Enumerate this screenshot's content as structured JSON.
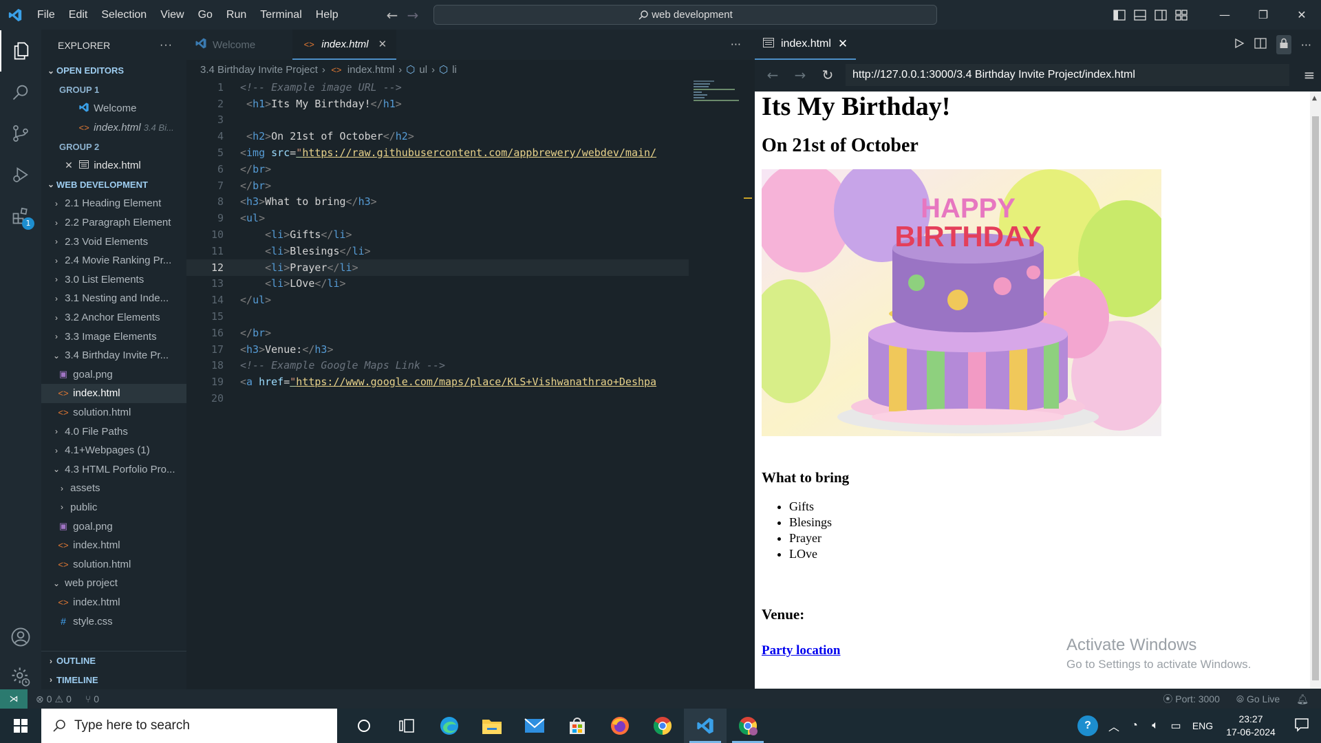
{
  "titlebar": {
    "menus": [
      "File",
      "Edit",
      "Selection",
      "View",
      "Go",
      "Run",
      "Terminal",
      "Help"
    ],
    "search_text": "web development"
  },
  "sidebar": {
    "title": "EXPLORER",
    "more": "···",
    "open_editors": "OPEN EDITORS",
    "group1": "GROUP 1",
    "group1_items": [
      {
        "label": "Welcome",
        "icon": "vscode-icon"
      },
      {
        "label": "index.html",
        "desc": "3.4 Bi...",
        "icon": "html-icon"
      }
    ],
    "group2": "GROUP 2",
    "group2_items": [
      {
        "label": "index.html",
        "icon": "preview-icon"
      }
    ],
    "workspace": "WEB DEVELOPMENT",
    "tree": [
      {
        "label": "2.1 Heading Element",
        "type": "folder",
        "depth": 1
      },
      {
        "label": "2.2 Paragraph Element",
        "type": "folder",
        "depth": 1
      },
      {
        "label": "2.3 Void Elements",
        "type": "folder",
        "depth": 1
      },
      {
        "label": "2.4 Movie Ranking Pr...",
        "type": "folder",
        "depth": 1
      },
      {
        "label": "3.0 List Elements",
        "type": "folder",
        "depth": 1
      },
      {
        "label": "3.1 Nesting and Inde...",
        "type": "folder",
        "depth": 1
      },
      {
        "label": "3.2 Anchor Elements",
        "type": "folder",
        "depth": 1
      },
      {
        "label": "3.3 Image Elements",
        "type": "folder",
        "depth": 1
      },
      {
        "label": "3.4 Birthday Invite Pr...",
        "type": "folder-open",
        "depth": 1
      },
      {
        "label": "goal.png",
        "type": "img",
        "depth": 2
      },
      {
        "label": "index.html",
        "type": "html",
        "depth": 2,
        "selected": true
      },
      {
        "label": "solution.html",
        "type": "html",
        "depth": 2
      },
      {
        "label": "4.0 File Paths",
        "type": "folder",
        "depth": 1
      },
      {
        "label": "4.1+Webpages (1)",
        "type": "folder",
        "depth": 1
      },
      {
        "label": "4.3 HTML Porfolio Pro...",
        "type": "folder-open",
        "depth": 1
      },
      {
        "label": "assets",
        "type": "folder",
        "depth": 2
      },
      {
        "label": "public",
        "type": "folder",
        "depth": 2
      },
      {
        "label": "goal.png",
        "type": "img",
        "depth": 2
      },
      {
        "label": "index.html",
        "type": "html",
        "depth": 2
      },
      {
        "label": "solution.html",
        "type": "html",
        "depth": 2
      },
      {
        "label": "web project",
        "type": "folder-open",
        "depth": 1
      },
      {
        "label": "index.html",
        "type": "html",
        "depth": 2
      },
      {
        "label": "style.css",
        "type": "css",
        "depth": 2
      }
    ],
    "outline": "OUTLINE",
    "timeline": "TIMELINE"
  },
  "editor": {
    "tabs": [
      {
        "label": "Welcome",
        "active": false
      },
      {
        "label": "index.html",
        "active": true
      }
    ],
    "more": "···",
    "breadcrumb": [
      "3.4 Birthday Invite Project",
      "index.html",
      "ul",
      "li"
    ],
    "current_line": 12,
    "lines": [
      {
        "n": "1",
        "html": "<span class=\"cm\">&lt;!-- Example image URL --&gt;</span>"
      },
      {
        "n": "2",
        "html": " <span class=\"gr\">&lt;</span><span class=\"tg\">h1</span><span class=\"gr\">&gt;</span>Its My Birthday!<span class=\"gr\">&lt;/</span><span class=\"tg\">h1</span><span class=\"gr\">&gt;</span>"
      },
      {
        "n": "3",
        "html": ""
      },
      {
        "n": "4",
        "html": " <span class=\"gr\">&lt;</span><span class=\"tg\">h2</span><span class=\"gr\">&gt;</span>On 21st of October<span class=\"gr\">&lt;/</span><span class=\"tg\">h2</span><span class=\"gr\">&gt;</span>"
      },
      {
        "n": "5",
        "html": "<span class=\"gr\">&lt;</span><span class=\"tg\">img</span> <span class=\"at\">src</span>=<span class=\"st\">\"</span><span class=\"url\">https://raw.githubusercontent.com/appbrewery/webdev/main/</span>"
      },
      {
        "n": "6",
        "html": "<span class=\"gr\">&lt;/</span><span class=\"tg\">br</span><span class=\"gr\">&gt;</span>"
      },
      {
        "n": "7",
        "html": "<span class=\"gr\">&lt;/</span><span class=\"tg\">br</span><span class=\"gr\">&gt;</span>"
      },
      {
        "n": "8",
        "html": "<span class=\"gr\">&lt;</span><span class=\"tg\">h3</span><span class=\"gr\">&gt;</span>What to bring<span class=\"gr\">&lt;/</span><span class=\"tg\">h3</span><span class=\"gr\">&gt;</span>"
      },
      {
        "n": "9",
        "html": "<span class=\"gr\">&lt;</span><span class=\"tg\">ul</span><span class=\"gr\">&gt;</span>"
      },
      {
        "n": "10",
        "html": "    <span class=\"gr\">&lt;</span><span class=\"tg\">li</span><span class=\"gr\">&gt;</span>Gifts<span class=\"gr\">&lt;/</span><span class=\"tg\">li</span><span class=\"gr\">&gt;</span>"
      },
      {
        "n": "11",
        "html": "    <span class=\"gr\">&lt;</span><span class=\"tg\">li</span><span class=\"gr\">&gt;</span>Blesings<span class=\"gr\">&lt;/</span><span class=\"tg\">li</span><span class=\"gr\">&gt;</span>"
      },
      {
        "n": "12",
        "html": "    <span class=\"gr\">&lt;</span><span class=\"tg\">li</span><span class=\"gr\">&gt;</span>Prayer<span class=\"gr\">&lt;/</span><span class=\"tg\">li</span><span class=\"gr\">&gt;</span>"
      },
      {
        "n": "13",
        "html": "    <span class=\"gr\">&lt;</span><span class=\"tg\">li</span><span class=\"gr\">&gt;</span>LOve<span class=\"gr\">&lt;/</span><span class=\"tg\">li</span><span class=\"gr\">&gt;</span>"
      },
      {
        "n": "14",
        "html": "<span class=\"gr\">&lt;/</span><span class=\"tg\">ul</span><span class=\"gr\">&gt;</span>"
      },
      {
        "n": "15",
        "html": ""
      },
      {
        "n": "16",
        "html": "<span class=\"gr\">&lt;/</span><span class=\"tg\">br</span><span class=\"gr\">&gt;</span>"
      },
      {
        "n": "17",
        "html": "<span class=\"gr\">&lt;</span><span class=\"tg\">h3</span><span class=\"gr\">&gt;</span>Venue:<span class=\"gr\">&lt;/</span><span class=\"tg\">h3</span><span class=\"gr\">&gt;</span>"
      },
      {
        "n": "18",
        "html": "<span class=\"cm\">&lt;!-- Example Google Maps Link --&gt;</span>"
      },
      {
        "n": "19",
        "html": "<span class=\"gr\">&lt;</span><span class=\"tg\">a</span> <span class=\"at\">href</span>=<span class=\"st\">\"</span><span class=\"url\">https://www.google.com/maps/place/KLS+Vishwanathrao+Deshpa</span>"
      },
      {
        "n": "20",
        "html": ""
      }
    ]
  },
  "preview": {
    "tab_label": "index.html",
    "url": "http://127.0.0.1:3000/3.4 Birthday Invite Project/index.html",
    "page": {
      "h1": "Its My Birthday!",
      "h2": "On 21st of October",
      "image_alt": "HAPPY BIRTHDAY cake",
      "cake_text_top": "HAPPY",
      "cake_text_bottom": "BIRTHDAY",
      "h3_bring": "What to bring",
      "items": [
        "Gifts",
        "Blesings",
        "Prayer",
        "LOve"
      ],
      "h3_venue": "Venue:",
      "link": "Party location"
    }
  },
  "watermark": {
    "title": "Activate Windows",
    "sub": "Go to Settings to activate Windows."
  },
  "statusbar": {
    "errors": "0",
    "warnings": "0",
    "ports": "0",
    "port": "Port: 3000",
    "golive": "Go Live"
  },
  "taskbar": {
    "search_placeholder": "Type here to search",
    "lang": "ENG",
    "time": "23:27",
    "date": "17-06-2024",
    "apps": [
      "cortana-icon",
      "task-view-icon",
      "edge-icon",
      "file-explorer-icon",
      "mail-icon",
      "store-icon",
      "firefox-icon",
      "chrome-icon",
      "vscode-icon",
      "chrome-profile-icon"
    ]
  },
  "activity": {
    "extensions_badge": "1"
  }
}
